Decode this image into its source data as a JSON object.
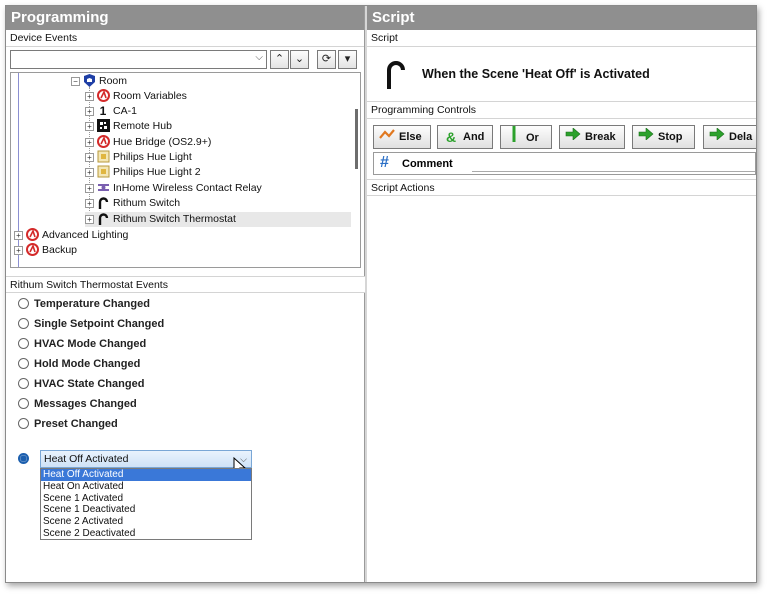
{
  "left_pane": {
    "title": "Programming",
    "device_events_label": "Device Events",
    "combo_value": "",
    "tree": [
      {
        "label": "Room",
        "icon": "room-icon",
        "expander": "-"
      },
      {
        "label": "Room Variables",
        "icon": "variables-icon",
        "expander": "+"
      },
      {
        "label": "CA-1",
        "icon": "ca1-icon",
        "expander": "+"
      },
      {
        "label": "Remote Hub",
        "icon": "remote-hub-icon",
        "expander": "+"
      },
      {
        "label": "Hue Bridge (OS2.9+)",
        "icon": "hue-bridge-icon",
        "expander": "+"
      },
      {
        "label": "Philips Hue Light",
        "icon": "light-icon",
        "expander": "+"
      },
      {
        "label": "Philips Hue Light 2",
        "icon": "light-icon",
        "expander": "+"
      },
      {
        "label": "InHome Wireless Contact Relay",
        "icon": "relay-icon",
        "expander": "+"
      },
      {
        "label": "Rithum Switch",
        "icon": "switch-icon",
        "expander": "+"
      },
      {
        "label": "Rithum Switch Thermostat",
        "icon": "switch-icon",
        "expander": "+"
      },
      {
        "label": "Advanced Lighting",
        "icon": "lighting-icon",
        "expander": "+"
      },
      {
        "label": "Backup",
        "icon": "backup-icon",
        "expander": "+"
      }
    ],
    "events_label": "Rithum Switch Thermostat Events",
    "events": [
      "Temperature Changed",
      "Single Setpoint Changed",
      "HVAC Mode Changed",
      "Hold Mode Changed",
      "HVAC State Changed",
      "Messages Changed",
      "Preset Changed"
    ],
    "select_value": "Heat Off Activated",
    "select_options": [
      "Heat Off Activated",
      "Heat On Activated",
      "Scene 1 Activated",
      "Scene 1 Deactivated",
      "Scene 2 Activated",
      "Scene 2 Deactivated"
    ]
  },
  "right_pane": {
    "title": "Script",
    "script_label": "Script",
    "script_text": "When the Scene 'Heat Off' is Activated",
    "controls_label": "Programming Controls",
    "controls": [
      {
        "label": "Else",
        "icon": "else-icon"
      },
      {
        "label": "And",
        "icon": "and-icon"
      },
      {
        "label": "Or",
        "icon": "or-icon"
      },
      {
        "label": "Break",
        "icon": "break-arrow-icon"
      },
      {
        "label": "Stop",
        "icon": "stop-arrow-icon"
      },
      {
        "label": "Dela",
        "icon": "delay-arrow-icon"
      }
    ],
    "comment_label": "Comment",
    "actions_label": "Script Actions"
  },
  "colors": {
    "title_bar": "#8f8f8f",
    "accent_red": "#d42a2a",
    "arrow_green": "#2ca12c",
    "comment_blue": "#2b6fc6",
    "selection_blue": "#3a78d8"
  }
}
